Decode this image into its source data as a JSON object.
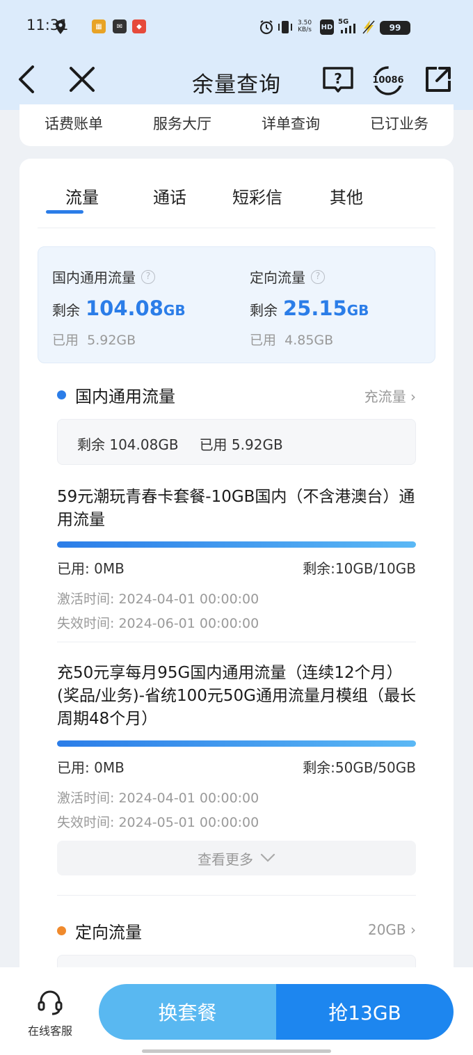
{
  "status_bar": {
    "time": "11:31",
    "net_speed_value": "3.50",
    "net_speed_unit": "KB/s",
    "hd_label": "HD",
    "network_label": "5G",
    "battery_level": "99",
    "icons": [
      "location-icon",
      "app-notification-icon",
      "message-icon",
      "app-badge-icon",
      "alarm-icon",
      "vibrate-icon",
      "signal-icon",
      "charging-icon"
    ]
  },
  "header": {
    "title": "余量查询",
    "hotline_label": "10086",
    "icons": [
      "back-arrow-icon",
      "close-icon",
      "help-book-icon",
      "hotline-icon",
      "share-icon"
    ]
  },
  "quick_nav": {
    "items": [
      "话费账单",
      "服务大厅",
      "详单查询",
      "已订业务"
    ]
  },
  "tabs": {
    "items": [
      "流量",
      "通话",
      "短彩信",
      "其他"
    ],
    "active": "流量"
  },
  "summary": {
    "general": {
      "label": "国内通用流量",
      "remain_label": "剩余",
      "remain_value": "104.08",
      "remain_unit": "GB",
      "used_label": "已用",
      "used_value": "5.92GB"
    },
    "directed": {
      "label": "定向流量",
      "remain_label": "剩余",
      "remain_value": "25.15",
      "remain_unit": "GB",
      "used_label": "已用",
      "used_value": "4.85GB"
    }
  },
  "general_section": {
    "title": "国内通用流量",
    "link": "充流量",
    "remain_text": "剩余 104.08GB",
    "used_text": "已用 5.92GB",
    "dot_color": "#2b7de8"
  },
  "packages": [
    {
      "name": "59元潮玩青春卡套餐-10GB国内（不含港澳台）通用流量",
      "used": "已用: 0MB",
      "remain": "剩余:10GB/10GB",
      "activate": "激活时间: 2024-04-01 00:00:00",
      "expire": "失效时间: 2024-06-01 00:00:00",
      "remain_fraction": 1.0
    },
    {
      "name": "充50元享每月95G国内通用流量（连续12个月）(奖品/业务)-省统100元50G通用流量月模组（最长周期48个月）",
      "used": "已用: 0MB",
      "remain": "剩余:50GB/50GB",
      "activate": "激活时间: 2024-04-01 00:00:00",
      "expire": "失效时间: 2024-05-01 00:00:00",
      "remain_fraction": 1.0
    }
  ],
  "more_button": "查看更多",
  "directed_section": {
    "title": "定向流量",
    "link": "20GB",
    "dot_color": "#f08a2c"
  },
  "bottom_bar": {
    "service_label": "在线客服",
    "cta_left": "换套餐",
    "cta_right": "抢13GB"
  },
  "colors": {
    "accent": "#2b7de8",
    "header_bg": "#dcebfb",
    "cta_left": "#59b8f1",
    "cta_right": "#1d86ef"
  }
}
